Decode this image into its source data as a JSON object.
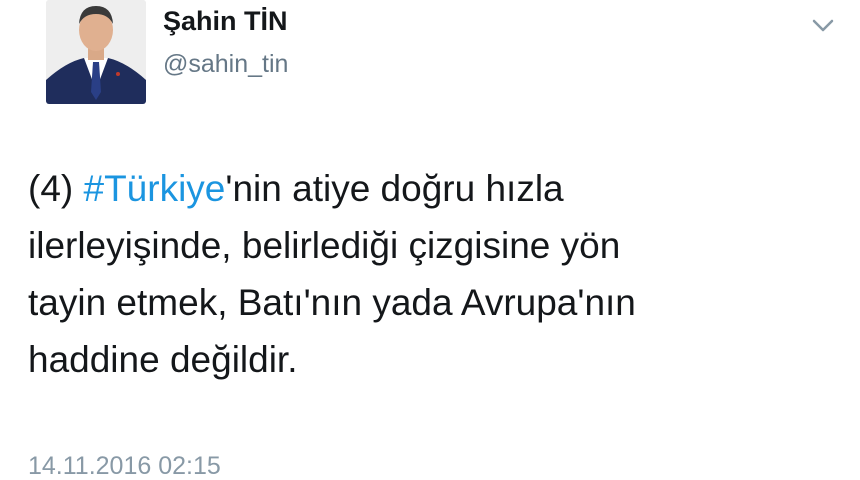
{
  "author": {
    "display_name": "Şahin TİN",
    "handle": "@sahin_tin"
  },
  "tweet": {
    "line1_prefix": "(4) ",
    "hashtag": "#Türkiye",
    "line1_suffix": "'nin atiye doğru hızla",
    "line2": "ilerleyişinde, belirlediği çizgisine yön",
    "line3": "tayin etmek, Batı'nın yada Avrupa'nın",
    "line4": "haddine değildir.",
    "timestamp": "14.11.2016 02:15"
  },
  "icons": {
    "caret": "chevron-down-icon",
    "avatar": "avatar"
  },
  "colors": {
    "hashtag": "#1b95e0",
    "handle": "#657786",
    "timestamp": "#8899a6"
  }
}
